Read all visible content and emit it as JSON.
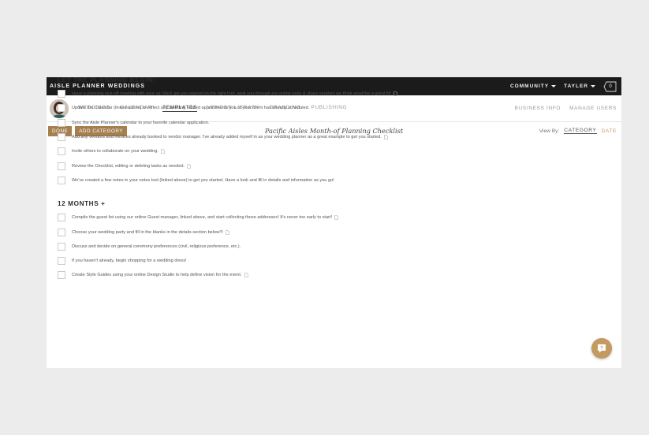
{
  "app": {
    "brand": "AISLE PLANNER WEDDINGS",
    "community_menu": "COMMUNITY",
    "user_menu": "TAYLER",
    "notification_count": "0"
  },
  "nav": {
    "links": [
      "WEDDINGS",
      "CALENDAR",
      "TEMPLATES",
      "VENDOR LIBRARY",
      "BRANDING",
      "PUBLISHING"
    ],
    "active": "TEMPLATES",
    "right_links": [
      "BUSINESS INFO",
      "MANAGE USERS"
    ]
  },
  "toolbar": {
    "done_label": "DONE",
    "add_category_label": "ADD CATEGORY",
    "document_title": "Pacific Aisles Month-of Planning Checklist",
    "view_by_label": "View By:",
    "view_options": [
      "CATEGORY",
      "DATE"
    ],
    "view_selected": "CATEGORY"
  },
  "sections": [
    {
      "title": "LET THE PLANNING BEGIN!",
      "tasks": [
        {
          "text": "Have a planning kick-off meeting with your us! We'll get you started on the right foot, walk you through our online tools & share vendors we think woud be a great fit!",
          "has_note": true
        },
        {
          "text": "Update the Calendar (linked above) to reflect any wedding related appointments you or your client has already scheduled.",
          "has_note": false
        },
        {
          "text": "Sync the Aisle Planner's calendar to your favorite calendar application.",
          "has_note": false
        },
        {
          "text": "Add any vendors and invoices already booked to vendor manager. I've already added myself in as your wedding planner as a great example to get you started.",
          "has_note": true
        },
        {
          "text": "Invite others to collaborate on your wedding.",
          "has_note": true
        },
        {
          "text": "Review the Checklist, editing or deleting tasks as needed.",
          "has_note": true
        },
        {
          "text": "We've created a few notes in your notes tool (linked above) to get you started. Have a look and fill in details and information as you go!",
          "has_note": false
        }
      ]
    },
    {
      "title": "12 MONTHS +",
      "tasks": [
        {
          "text": "Compile the guest list using our online Guest manager, linked above, and start collecting those addresses! It's never too early to start!",
          "has_note": true
        },
        {
          "text": "Choose your wedding party and fill in the blanks in the details section below!!!",
          "has_note": true
        },
        {
          "text": "Discuss and decide on general ceremony preferences (civil, religious preference, etc.).",
          "has_note": false
        },
        {
          "text": "If you haven't already, begin shopping for a wedding dress!",
          "has_note": false
        },
        {
          "text": "Create Style Guides using your online Design Studio to help define vision for the event.",
          "has_note": true
        }
      ]
    }
  ],
  "colors": {
    "topbar_bg": "#1b1b1b",
    "accent": "#a67f4f",
    "help_button": "#c29a62",
    "page_bg": "#ececed"
  },
  "icons": {
    "note": "document-note-icon",
    "help": "chat-question-icon",
    "notifications": "notification-tag-icon"
  }
}
